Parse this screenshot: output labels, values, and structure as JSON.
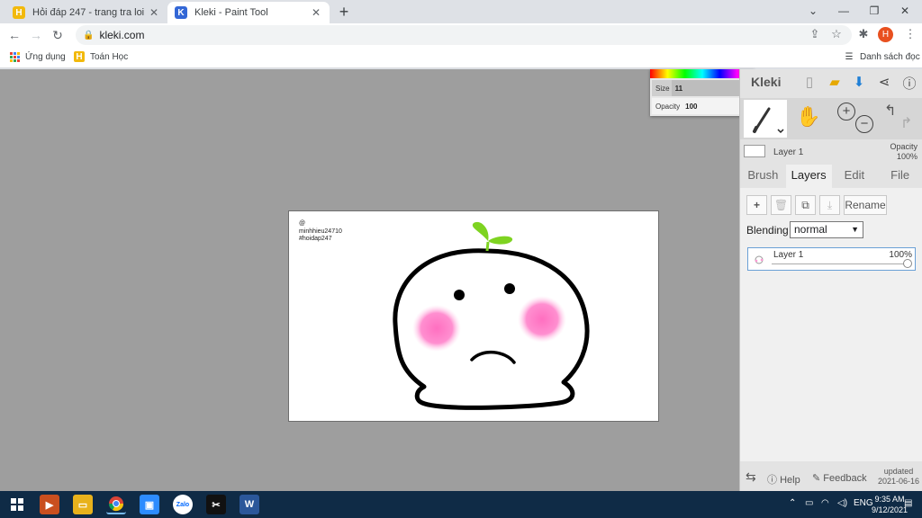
{
  "browser": {
    "tabs": [
      {
        "title": "Hỏi đáp 247 - trang tra loi",
        "favicon": "H",
        "favicon_color": "#f2b90c",
        "active": false
      },
      {
        "title": "Kleki - Paint Tool",
        "favicon": "K",
        "favicon_color": "#3367d6",
        "active": true
      }
    ],
    "new_tab": "+",
    "window_controls": {
      "dropdown": "⌄",
      "minimize": "—",
      "restore": "❐",
      "close": "✕"
    },
    "nav": {
      "back": "←",
      "forward": "→",
      "reload": "↻"
    },
    "url": "kleki.com",
    "avatar_letter": "H",
    "bookmarks": [
      {
        "label": "Ứng dụng",
        "icon": "apps-grid-icon"
      },
      {
        "label": "Toán Học",
        "icon": "hoidap-icon"
      }
    ],
    "reading_list": "Danh sách đọc"
  },
  "kleki": {
    "logo": "Kleki",
    "canvas_text": [
      "@",
      "minhhieu24710",
      "#hoidap247"
    ],
    "brush_popup": {
      "size_label": "Size",
      "size_value": "11",
      "opacity_label": "Opacity",
      "opacity_value": "100"
    },
    "layer_header": {
      "name": "Layer 1",
      "opacity_label": "Opacity",
      "opacity_value": "100%"
    },
    "tabs": [
      "Brush",
      "Layers",
      "Edit",
      "File"
    ],
    "selected_tab": "Layers",
    "layer_buttons": {
      "add": "+",
      "delete": "🗑",
      "duplicate": "⧉",
      "merge": "⤓",
      "rename": "Rename"
    },
    "blending": {
      "label": "Blending",
      "value": "normal"
    },
    "layers": [
      {
        "name": "Layer 1",
        "opacity": "100%"
      }
    ],
    "footer": {
      "help": "Help",
      "feedback": "Feedback",
      "updated_label": "updated",
      "updated_date": "2021-06-16"
    },
    "colors": {
      "accent": "#3c8fd6",
      "sprout": "#7ed321",
      "blush": "#ff7ac8"
    }
  },
  "taskbar": {
    "language": "ENG",
    "time": "9:35 AM",
    "date": "9/12/2021"
  }
}
